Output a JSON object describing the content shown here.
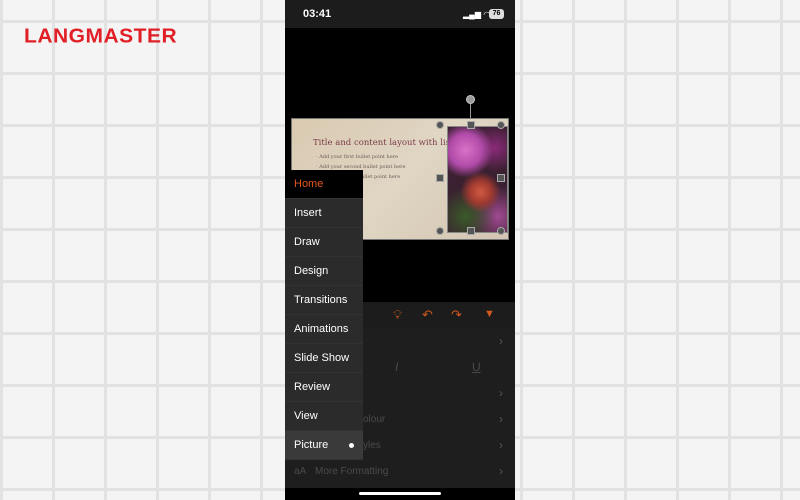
{
  "brand": {
    "logo": "LANGMASTER",
    "color": "#e01f26"
  },
  "status_bar": {
    "time": "03:41",
    "battery": "76"
  },
  "slide": {
    "title": "Title and content layout with list",
    "bullets": [
      "Add your first bullet point here",
      "Add your second bullet point here",
      "Add your third bullet point here"
    ]
  },
  "menu": {
    "items": [
      {
        "label": "Home",
        "active": true
      },
      {
        "label": "Insert"
      },
      {
        "label": "Draw"
      },
      {
        "label": "Design"
      },
      {
        "label": "Transitions"
      },
      {
        "label": "Animations"
      },
      {
        "label": "Slide Show"
      },
      {
        "label": "Review"
      },
      {
        "label": "View"
      },
      {
        "label": "Picture",
        "selected": true
      }
    ],
    "accent": "#e2581d"
  },
  "panel": {
    "row_colour": "olour",
    "row_styles": "yles",
    "more_formatting": "More Formatting"
  }
}
